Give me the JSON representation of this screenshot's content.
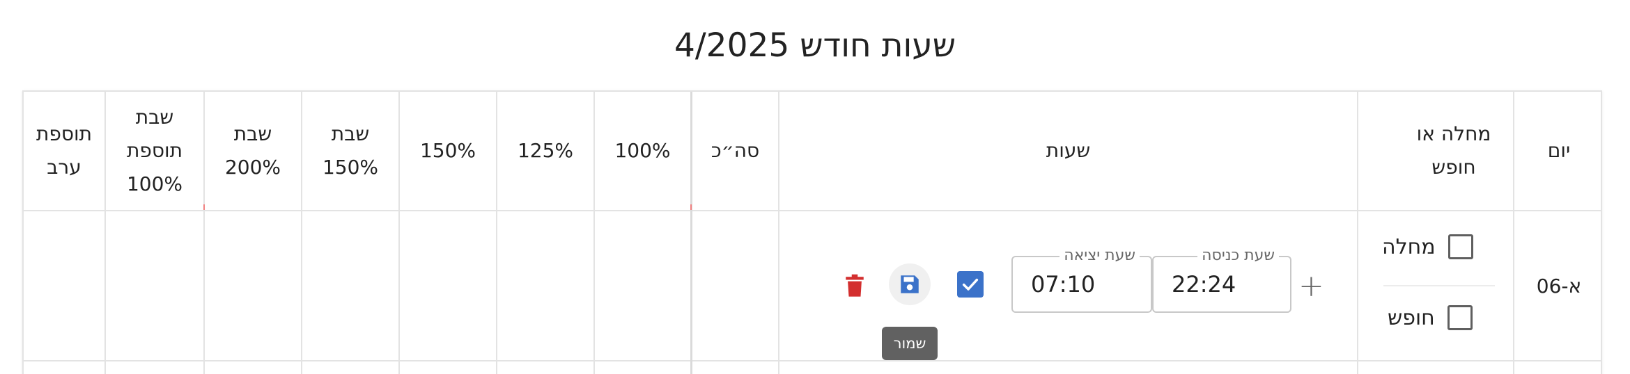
{
  "page": {
    "title": "שעות חודש 4/2025"
  },
  "table": {
    "headers": {
      "day": "יום",
      "sick_or_vacation": "מחלה או חופש",
      "hours": "שעות",
      "total": "סה״כ",
      "p100": "100%",
      "p125": "125%",
      "p150": "150%",
      "shabbat150": "שבת 150%",
      "shabbat200": "שבת 200%",
      "shabbat_extra100": "שבת תוספת 100%",
      "evening_extra": "תוספת ערב"
    },
    "rows": [
      {
        "day": "א-06",
        "sick_label": "מחלה",
        "sick_checked": false,
        "vacation_label": "חופש",
        "vacation_checked": false,
        "entry_label": "שעת כניסה",
        "entry_time": "22:24",
        "exit_label": "שעת יציאה",
        "exit_time": "07:10",
        "confirmed": true
      }
    ]
  },
  "tooltip": {
    "save": "שמור"
  },
  "colors": {
    "accent": "#3b72c9",
    "delete": "#d32f2f",
    "tooltip_bg": "#616161"
  },
  "icons": {
    "add": "plus-icon",
    "confirm": "check-icon",
    "save": "floppy-disk-icon",
    "delete": "trash-icon"
  }
}
